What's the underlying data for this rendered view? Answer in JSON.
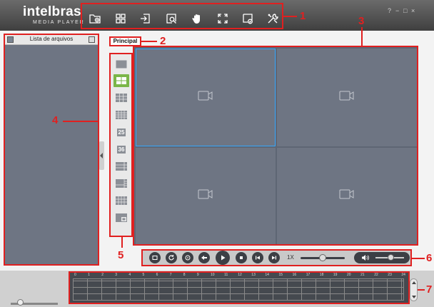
{
  "header": {
    "logo_main": "intelbras",
    "logo_sub": "MEDIA PLAYER",
    "window_controls": [
      "?",
      "−",
      "□",
      "×"
    ]
  },
  "toolbar": {
    "buttons": [
      {
        "icon": "add-folder-icon"
      },
      {
        "icon": "grid-icon"
      },
      {
        "icon": "export-icon"
      },
      {
        "icon": "search-file-icon"
      },
      {
        "icon": "hand-icon"
      },
      {
        "icon": "fullscreen-icon"
      },
      {
        "icon": "convert-icon"
      },
      {
        "icon": "tools-icon"
      }
    ]
  },
  "callouts": [
    "1",
    "2",
    "3",
    "4",
    "5",
    "6",
    "7"
  ],
  "file_panel": {
    "title": "Lista de arquivos"
  },
  "tab": {
    "label": "Principal"
  },
  "layouts": [
    "1",
    "4",
    "9",
    "16",
    "25",
    "36",
    "8",
    "13",
    "16b",
    "custom"
  ],
  "layout_labels": {
    "l25": "25",
    "l36": "36"
  },
  "active_layout": "4",
  "playback": {
    "speed": "1X",
    "volume_icon": "speaker-icon"
  },
  "timeline": {
    "hours": [
      "0",
      "1",
      "2",
      "3",
      "4",
      "5",
      "6",
      "7",
      "8",
      "9",
      "10",
      "11",
      "12",
      "13",
      "14",
      "15",
      "16",
      "17",
      "18",
      "19",
      "20",
      "21",
      "22",
      "23",
      "24"
    ]
  },
  "colors": {
    "accent": "#e02020",
    "active_layout": "#7ab648",
    "selection": "#36a8ff"
  }
}
